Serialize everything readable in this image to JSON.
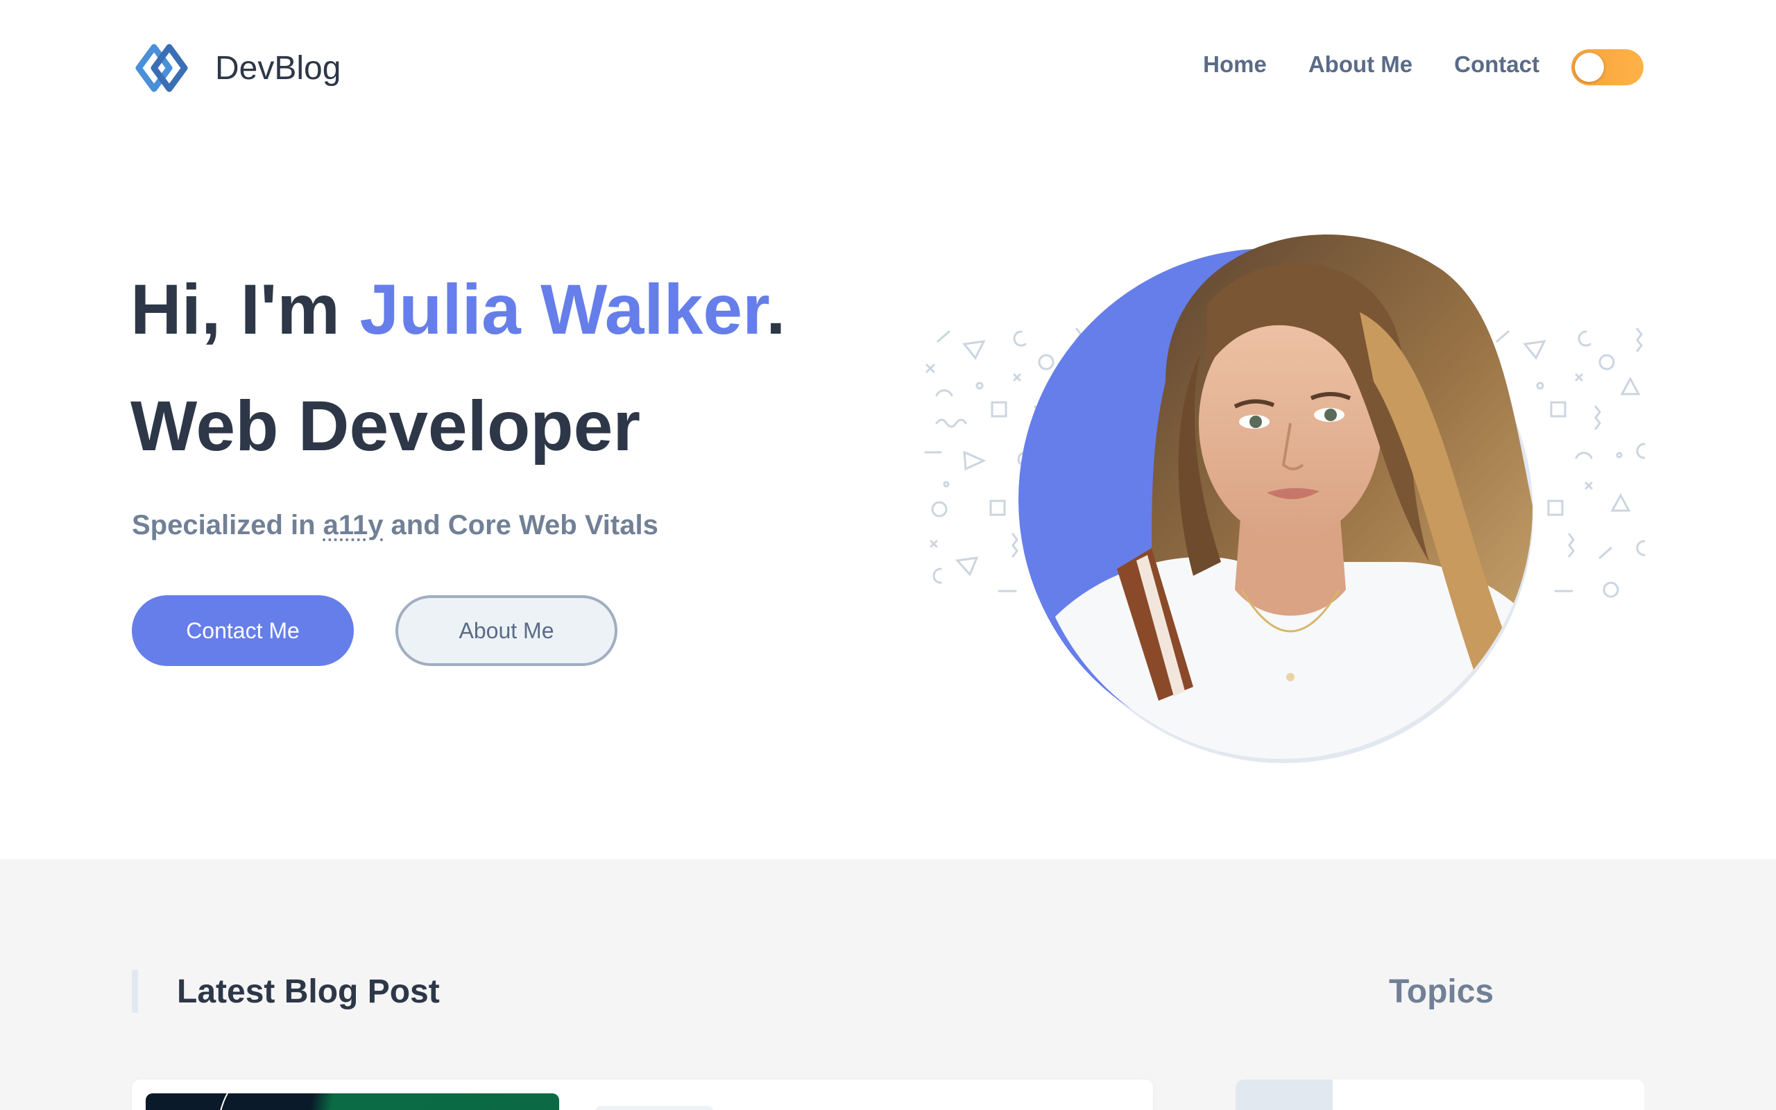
{
  "brand": {
    "name": "DevBlog"
  },
  "nav": {
    "items": [
      {
        "label": "Home"
      },
      {
        "label": "About Me"
      },
      {
        "label": "Contact"
      }
    ]
  },
  "theme_toggle": {
    "state": "light",
    "accent": "#f6a13b"
  },
  "hero": {
    "greeting": "Hi, I'm ",
    "name": "Julia Walker",
    "period": ".",
    "role": "Web Developer",
    "subtitle_prefix": "Specialized in ",
    "subtitle_abbr": "a11y",
    "subtitle_suffix": " and Core Web Vitals",
    "primary_button": "Contact Me",
    "secondary_button": "About Me",
    "accent_color": "#667eea"
  },
  "sections": {
    "latest_post_title": "Latest Blog Post",
    "topics_title": "Topics"
  },
  "colors": {
    "text": "#2d3748",
    "muted": "#718096",
    "accent": "#667eea",
    "section_bg": "#f5f5f5"
  }
}
